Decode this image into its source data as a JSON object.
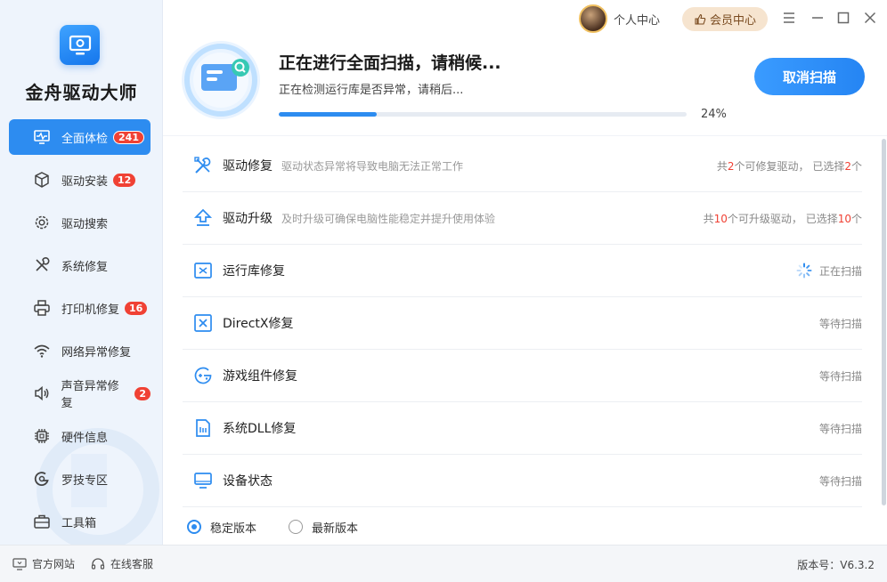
{
  "app": {
    "title": "金舟驱动大师"
  },
  "topbar": {
    "personal_center": "个人中心",
    "vip_center": "会员中心"
  },
  "sidebar": {
    "items": [
      {
        "label": "全面体检",
        "badge": "241",
        "icon": "monitor-scan-icon",
        "active": true
      },
      {
        "label": "驱动安装",
        "badge": "12",
        "icon": "package-icon"
      },
      {
        "label": "驱动搜索",
        "badge": "",
        "icon": "gear-search-icon"
      },
      {
        "label": "系统修复",
        "badge": "",
        "icon": "wrench-icon"
      },
      {
        "label": "打印机修复",
        "badge": "16",
        "icon": "printer-icon"
      },
      {
        "label": "网络异常修复",
        "badge": "",
        "icon": "wifi-icon"
      },
      {
        "label": "声音异常修复",
        "badge": "2",
        "icon": "speaker-icon"
      },
      {
        "label": "硬件信息",
        "badge": "",
        "icon": "chip-icon"
      },
      {
        "label": "罗技专区",
        "badge": "",
        "icon": "logitech-icon"
      },
      {
        "label": "工具箱",
        "badge": "",
        "icon": "toolbox-icon"
      }
    ]
  },
  "scan": {
    "title": "正在进行全面扫描，请稍候...",
    "subtitle": "正在检测运行库是否异常，请稍后...",
    "progress": 24,
    "percent_text": "24%",
    "cancel_label": "取消扫描"
  },
  "rows": [
    {
      "name": "驱动修复",
      "desc": "驱动状态异常将导致电脑无法正常工作",
      "status_parts": [
        "共",
        "2",
        "个可修复驱动， 已选择",
        "2",
        "个"
      ],
      "icon": "tools-icon"
    },
    {
      "name": "驱动升级",
      "desc": "及时升级可确保电脑性能稳定并提升使用体验",
      "status_parts": [
        "共",
        "10",
        "个可升级驱动， 已选择",
        "10",
        "个"
      ],
      "icon": "upgrade-icon"
    },
    {
      "name": "运行库修复",
      "desc": "",
      "status": "正在扫描",
      "spinner": true,
      "icon": "runtime-icon"
    },
    {
      "name": "DirectX修复",
      "desc": "",
      "status": "等待扫描",
      "icon": "directx-icon"
    },
    {
      "name": "游戏组件修复",
      "desc": "",
      "status": "等待扫描",
      "icon": "gamepad-icon"
    },
    {
      "name": "系统DLL修复",
      "desc": "",
      "status": "等待扫描",
      "icon": "dll-file-icon"
    },
    {
      "name": "设备状态",
      "desc": "",
      "status": "等待扫描",
      "icon": "monitor-icon"
    }
  ],
  "version_options": {
    "stable": "稳定版本",
    "latest": "最新版本",
    "selected": "stable"
  },
  "footer": {
    "website": "官方网站",
    "support": "在线客服",
    "version": "版本号：V6.3.2"
  },
  "colors": {
    "accent": "#2d8cf0",
    "badge": "#f04134",
    "vip_bg": "#f6e4cf"
  }
}
